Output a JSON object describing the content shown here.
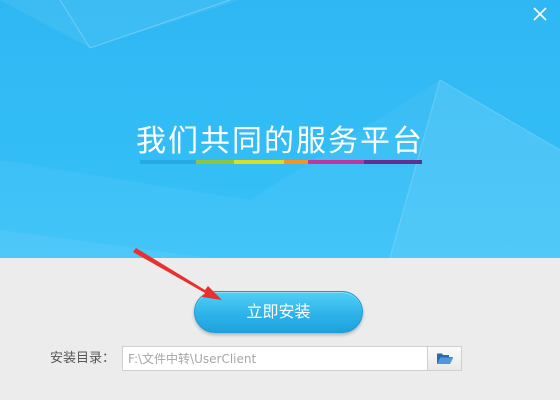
{
  "window": {
    "close_icon": "close-icon"
  },
  "banner": {
    "slogan": "我们共同的服务平台",
    "bar_colors": [
      "#27a9e1",
      "#8cc63f",
      "#d9e021",
      "#f7931e",
      "#c1369e",
      "#662d91"
    ]
  },
  "install": {
    "button_label": "立即安装"
  },
  "directory": {
    "label": "安装目录：",
    "path": "F:\\文件中转\\UserClient",
    "browse_icon": "folder-icon"
  },
  "colors": {
    "banner_blue": "#33bdf6",
    "button_blue": "#2fb3e9",
    "arrow_red": "#e8312f"
  }
}
